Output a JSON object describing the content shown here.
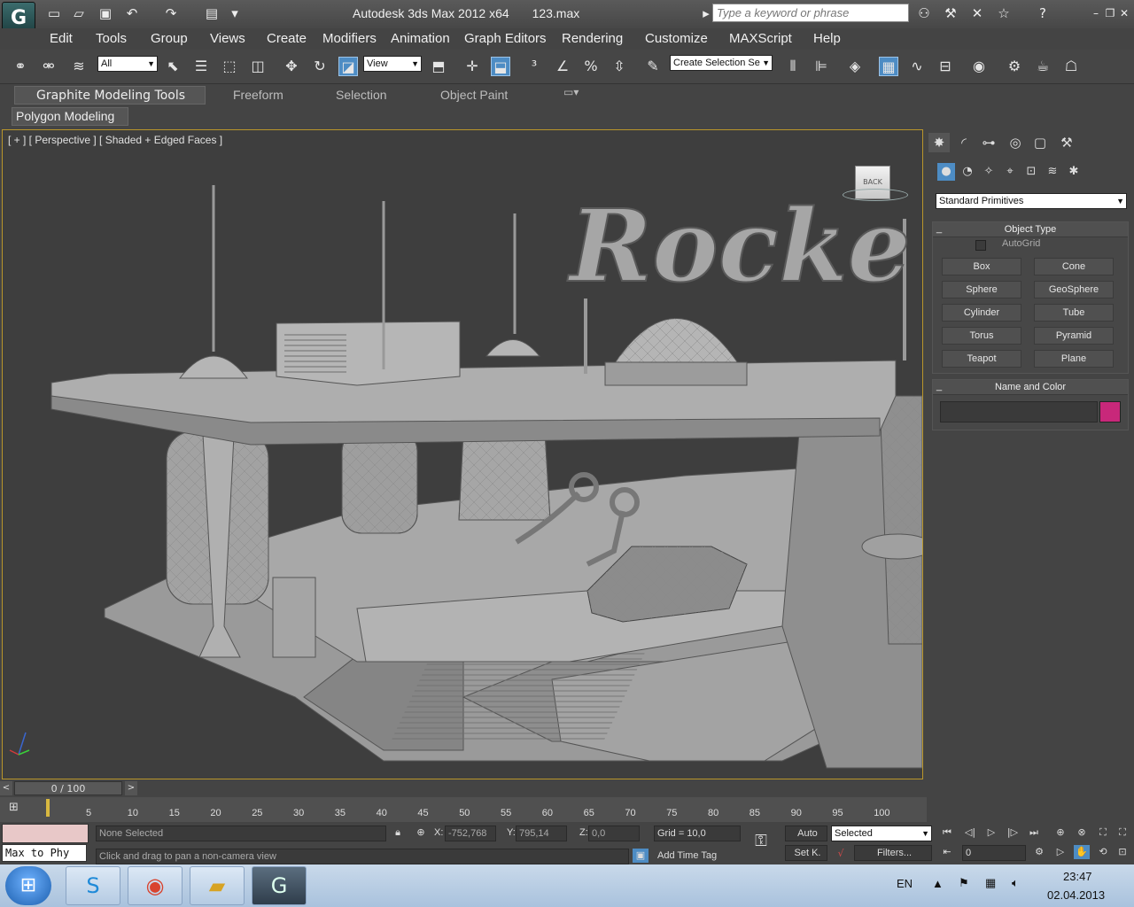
{
  "window": {
    "title": "Autodesk 3ds Max  2012 x64",
    "file": "123.max",
    "search_placeholder": "Type a keyword or phrase"
  },
  "menu": [
    "Edit",
    "Tools",
    "Group",
    "Views",
    "Create",
    "Modifiers",
    "Animation",
    "Graph Editors",
    "Rendering",
    "Customize",
    "MAXScript",
    "Help"
  ],
  "toolbar": {
    "selection_filter": "All",
    "ref_coord": "View",
    "named_selection": "Create Selection Se"
  },
  "ribbon": {
    "tabs": [
      "Graphite Modeling Tools",
      "Freeform",
      "Selection",
      "Object Paint"
    ],
    "panel": "Polygon Modeling"
  },
  "viewport": {
    "label": "[ + ] [ Perspective ] [ Shaded + Edged Faces ]",
    "scene_text": "Rocke",
    "cube_text": "BACK"
  },
  "command_panel": {
    "category": "Standard Primitives",
    "object_type_title": "Object Type",
    "autogrid": "AutoGrid",
    "primitives": [
      "Box",
      "Cone",
      "Sphere",
      "GeoSphere",
      "Cylinder",
      "Tube",
      "Torus",
      "Pyramid",
      "Teapot",
      "Plane"
    ],
    "name_color_title": "Name and Color",
    "object_color": "#c8287a"
  },
  "timeline": {
    "frame": "0 / 100",
    "ticks": [
      "5",
      "10",
      "15",
      "20",
      "25",
      "30",
      "35",
      "40",
      "45",
      "50",
      "55",
      "60",
      "65",
      "70",
      "75",
      "80",
      "85",
      "90",
      "95",
      "100"
    ]
  },
  "status": {
    "maxscript": "Max to Phy",
    "selection": "None Selected",
    "prompt": "Click and drag to pan a non-camera view",
    "x_label": "X:",
    "x": "-752,768",
    "y_label": "Y:",
    "y": "795,14",
    "z_label": "Z:",
    "z": "0,0",
    "grid": "Grid = 10,0",
    "add_time_tag": "Add Time Tag",
    "auto": "Auto",
    "set_key": "Set K.",
    "key_filter": "Selected",
    "filters": "Filters...",
    "current_frame": "0"
  },
  "taskbar": {
    "lang": "EN",
    "time": "23:47",
    "date": "02.04.2013"
  }
}
